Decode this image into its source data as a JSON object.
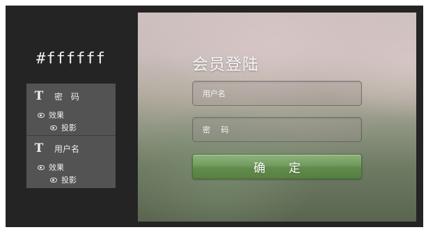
{
  "annotation": {
    "color_label": "#ffffff"
  },
  "layers": [
    {
      "type_icon": "T",
      "name": "密 码",
      "effects_label": "效果",
      "shadow_label": "投影"
    },
    {
      "type_icon": "T",
      "name": "用户名",
      "effects_label": "效果",
      "shadow_label": "投影"
    }
  ],
  "login": {
    "title": "会员登陆",
    "username_placeholder": "用户名",
    "password_placeholder": "密 码",
    "submit_label": "确 定"
  },
  "colors": {
    "canvas_bg": "#242424",
    "panel_bg": "#535353",
    "button_green": "#6f9a5c",
    "text_white": "#ffffff"
  },
  "icons": {
    "layer_type": "text-layer-icon",
    "visibility": "eye-icon"
  }
}
